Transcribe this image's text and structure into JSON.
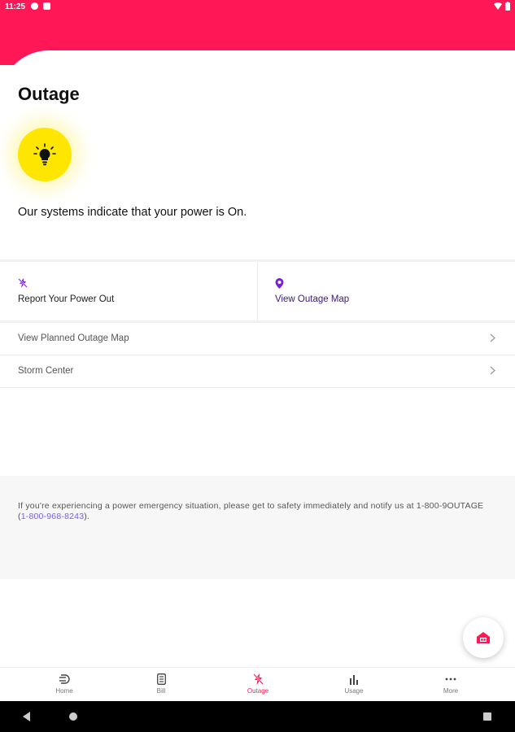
{
  "status_bar": {
    "time": "11:25",
    "left_icons": [
      "notification-icon",
      "sim-icon"
    ],
    "right_icons": [
      "wifi-icon",
      "battery-icon"
    ]
  },
  "header": {
    "title": "Outage"
  },
  "power_status": {
    "icon": "lightbulb-icon",
    "message": "Our systems indicate that your power is On."
  },
  "actions": [
    {
      "icon": "power-off-icon",
      "label": "Report Your Power Out"
    },
    {
      "icon": "map-pin-icon",
      "label": "View Outage Map"
    }
  ],
  "list_items": [
    {
      "label": "View Planned Outage Map"
    },
    {
      "label": "Storm Center"
    }
  ],
  "notice": {
    "text": "If you're experiencing a power emergency situation, please get to safety immediately and notify us at 1-800-9OUTAGE (",
    "phone": "1-800-968-8243",
    "suffix": ")."
  },
  "fab": {
    "icon": "home-alert-icon"
  },
  "bottom_nav": [
    {
      "icon": "home-icon",
      "label": "Home",
      "active": false
    },
    {
      "icon": "bill-icon",
      "label": "Bill",
      "active": false
    },
    {
      "icon": "outage-icon",
      "label": "Outage",
      "active": true
    },
    {
      "icon": "usage-icon",
      "label": "Usage",
      "active": false
    },
    {
      "icon": "more-icon",
      "label": "More",
      "active": false
    }
  ],
  "colors": {
    "brand": "#ff1855",
    "bulb": "#ffe600",
    "accent_purple": "#7a1fe0",
    "link": "#7a5cf0"
  }
}
